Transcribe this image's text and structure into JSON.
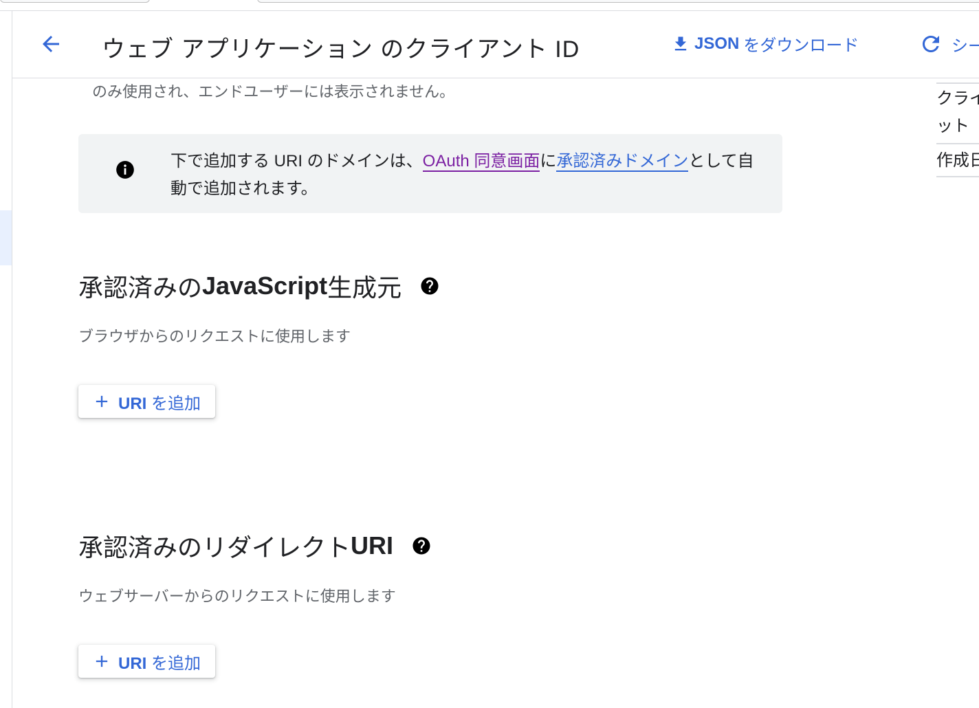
{
  "header": {
    "title": "ウェブ アプリケーション のクライアント ID",
    "download_bold": "JSON",
    "download_rest": " をダウンロード",
    "refresh_label": "シー"
  },
  "intro_cut_text": "のみ使用され、エンドユーザーには表示されません。",
  "info": {
    "text_before": "下で追加する URI のドメインは、",
    "link_consent": "OAuth 同意画面",
    "text_mid": "に",
    "link_domains": "承認済みドメイン",
    "text_after": "として自動で追加されます。"
  },
  "js_origins": {
    "title_prefix": "承認済みの ",
    "title_bold": "JavaScript",
    "title_suffix": " 生成元",
    "description": "ブラウザからのリクエストに使用します",
    "add_bold": "URI",
    "add_rest": " を追加"
  },
  "redirect_uris": {
    "title_prefix": "承認済みのリダイレクト ",
    "title_bold": "URI",
    "description": "ウェブサーバーからのリクエストに使用します",
    "add_bold": "URI",
    "add_rest": " を追加"
  },
  "side_panel": {
    "row1_line1": "クライ",
    "row1_line2": "ット",
    "row2": "作成日"
  },
  "colors": {
    "accent": "#3367d6",
    "visited_link": "#7b1fa2",
    "info_bg": "#f1f3f4",
    "secondary_text": "#5f6368"
  }
}
